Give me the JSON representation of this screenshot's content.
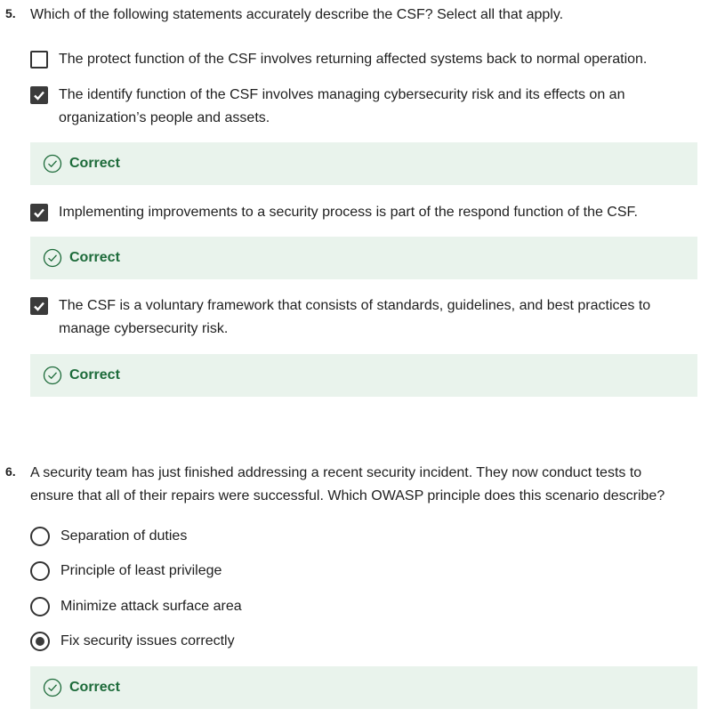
{
  "q5": {
    "number": "5.",
    "text": "Which of the following statements accurately describe the CSF? Select all that apply.",
    "options": [
      {
        "label": "The protect function of the CSF involves returning affected systems back to normal operation.",
        "checked": false
      },
      {
        "label": "The identify function of the CSF involves managing cybersecurity risk and its effects on an organization’s people and assets.",
        "checked": true,
        "feedback": "Correct"
      },
      {
        "label": "Implementing improvements to a security process is part of the respond function of the CSF.",
        "checked": true,
        "feedback": "Correct"
      },
      {
        "label": "The CSF is a voluntary framework that consists of standards, guidelines, and best practices to manage cybersecurity risk.",
        "checked": true,
        "feedback": "Correct"
      }
    ]
  },
  "q6": {
    "number": "6.",
    "text": "A security team has just finished addressing a recent security incident. They now conduct tests to ensure that all of their repairs were successful. Which OWASP principle does this scenario describe?",
    "options": [
      {
        "label": "Separation of duties",
        "selected": false
      },
      {
        "label": "Principle of least privilege",
        "selected": false
      },
      {
        "label": "Minimize attack surface area",
        "selected": false
      },
      {
        "label": "Fix security issues correctly",
        "selected": true
      }
    ],
    "feedback": "Correct"
  },
  "colors": {
    "feedback_bg": "#e9f3ec",
    "correct_green": "#1d6b3a",
    "checked_fill": "#3b3b3b"
  },
  "icons": {
    "checkbox_checked": "check-icon",
    "feedback": "check-circle-icon"
  }
}
